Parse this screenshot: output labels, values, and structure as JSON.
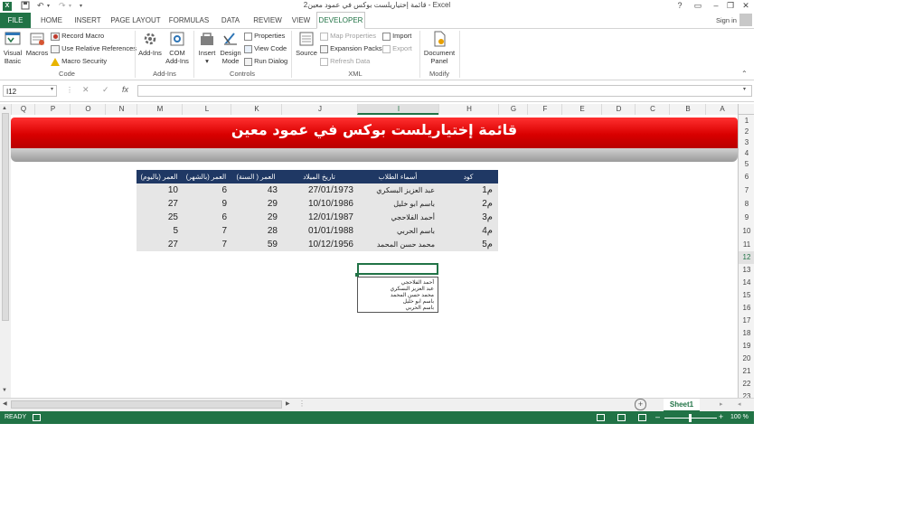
{
  "window": {
    "title": "قائمة إختياريلست بوكس في عمود معين2 - Excel",
    "controls": [
      "?",
      "▭",
      "–",
      "❐",
      "✕"
    ],
    "signin": "Sign in"
  },
  "tabs": [
    "FILE",
    "HOME",
    "INSERT",
    "PAGE LAYOUT",
    "FORMULAS",
    "DATA",
    "REVIEW",
    "VIEW",
    "DEVELOPER"
  ],
  "active_tab": "DEVELOPER",
  "ribbon": {
    "code": {
      "label": "Code",
      "visual_basic": "Visual Basic",
      "macros": "Macros",
      "record_macro": "Record Macro",
      "relative_refs": "Use Relative References",
      "macro_security": "Macro Security"
    },
    "addins": {
      "label": "Add-Ins",
      "addins": "Add-Ins",
      "com_addins": "COM Add-Ins"
    },
    "controls": {
      "label": "Controls",
      "insert": "Insert",
      "design_mode": "Design Mode",
      "properties": "Properties",
      "view_code": "View Code",
      "run_dialog": "Run Dialog"
    },
    "xml": {
      "label": "XML",
      "source": "Source",
      "map_properties": "Map Properties",
      "expansion_packs": "Expansion Packs",
      "refresh_data": "Refresh Data",
      "import": "Import",
      "export": "Export"
    },
    "modify": {
      "label": "Modify",
      "document_panel": "Document Panel"
    }
  },
  "formula_bar": {
    "name_box": "I12",
    "fx": "fx",
    "value": ""
  },
  "columns": [
    "Q",
    "P",
    "O",
    "N",
    "M",
    "L",
    "K",
    "J",
    "I",
    "H",
    "G",
    "F",
    "E",
    "D",
    "C",
    "B",
    "A"
  ],
  "selected_column": "I",
  "rows": [
    "1",
    "2",
    "3",
    "4",
    "5",
    "6",
    "7",
    "8",
    "9",
    "10",
    "11",
    "12",
    "13",
    "14",
    "15",
    "16",
    "17",
    "18",
    "19",
    "20",
    "21",
    "22",
    "23"
  ],
  "selected_row": "12",
  "sheet": {
    "banner_title": "قائمة إختياريلست بوكس في عمود معين",
    "table": {
      "headers": [
        "العمر (باليوم)",
        "العمر (بالشهر)",
        "العمر ( السنة)",
        "تاريخ الميلاد",
        "أسماء الطلاب",
        "كود"
      ],
      "rows": [
        [
          "10",
          "6",
          "43",
          "27/01/1973",
          "عبد العزيز البسكري",
          "م1"
        ],
        [
          "27",
          "9",
          "29",
          "10/10/1986",
          "باسم ابو خليل",
          "م2"
        ],
        [
          "25",
          "6",
          "29",
          "12/01/1987",
          "أحمد الفلاحجي",
          "م3"
        ],
        [
          "5",
          "7",
          "28",
          "01/01/1988",
          "باسم الحربي",
          "م4"
        ],
        [
          "27",
          "7",
          "59",
          "10/12/1956",
          "محمد حسن المحمد",
          "م5"
        ]
      ]
    },
    "listbox_items": [
      "أحمد الفلاحجي",
      "عبد العزيز البسكري",
      "محمد حسن المحمد",
      "باسم ابو خليل",
      "باسم الحربي"
    ]
  },
  "sheet_tabs": [
    "Sheet1"
  ],
  "status": {
    "ready": "READY",
    "zoom": "100 %"
  },
  "colors": {
    "excel_green": "#217346",
    "banner_red": "#e60000",
    "table_header": "#1f3864",
    "row_fill": "#e6e6e6"
  }
}
